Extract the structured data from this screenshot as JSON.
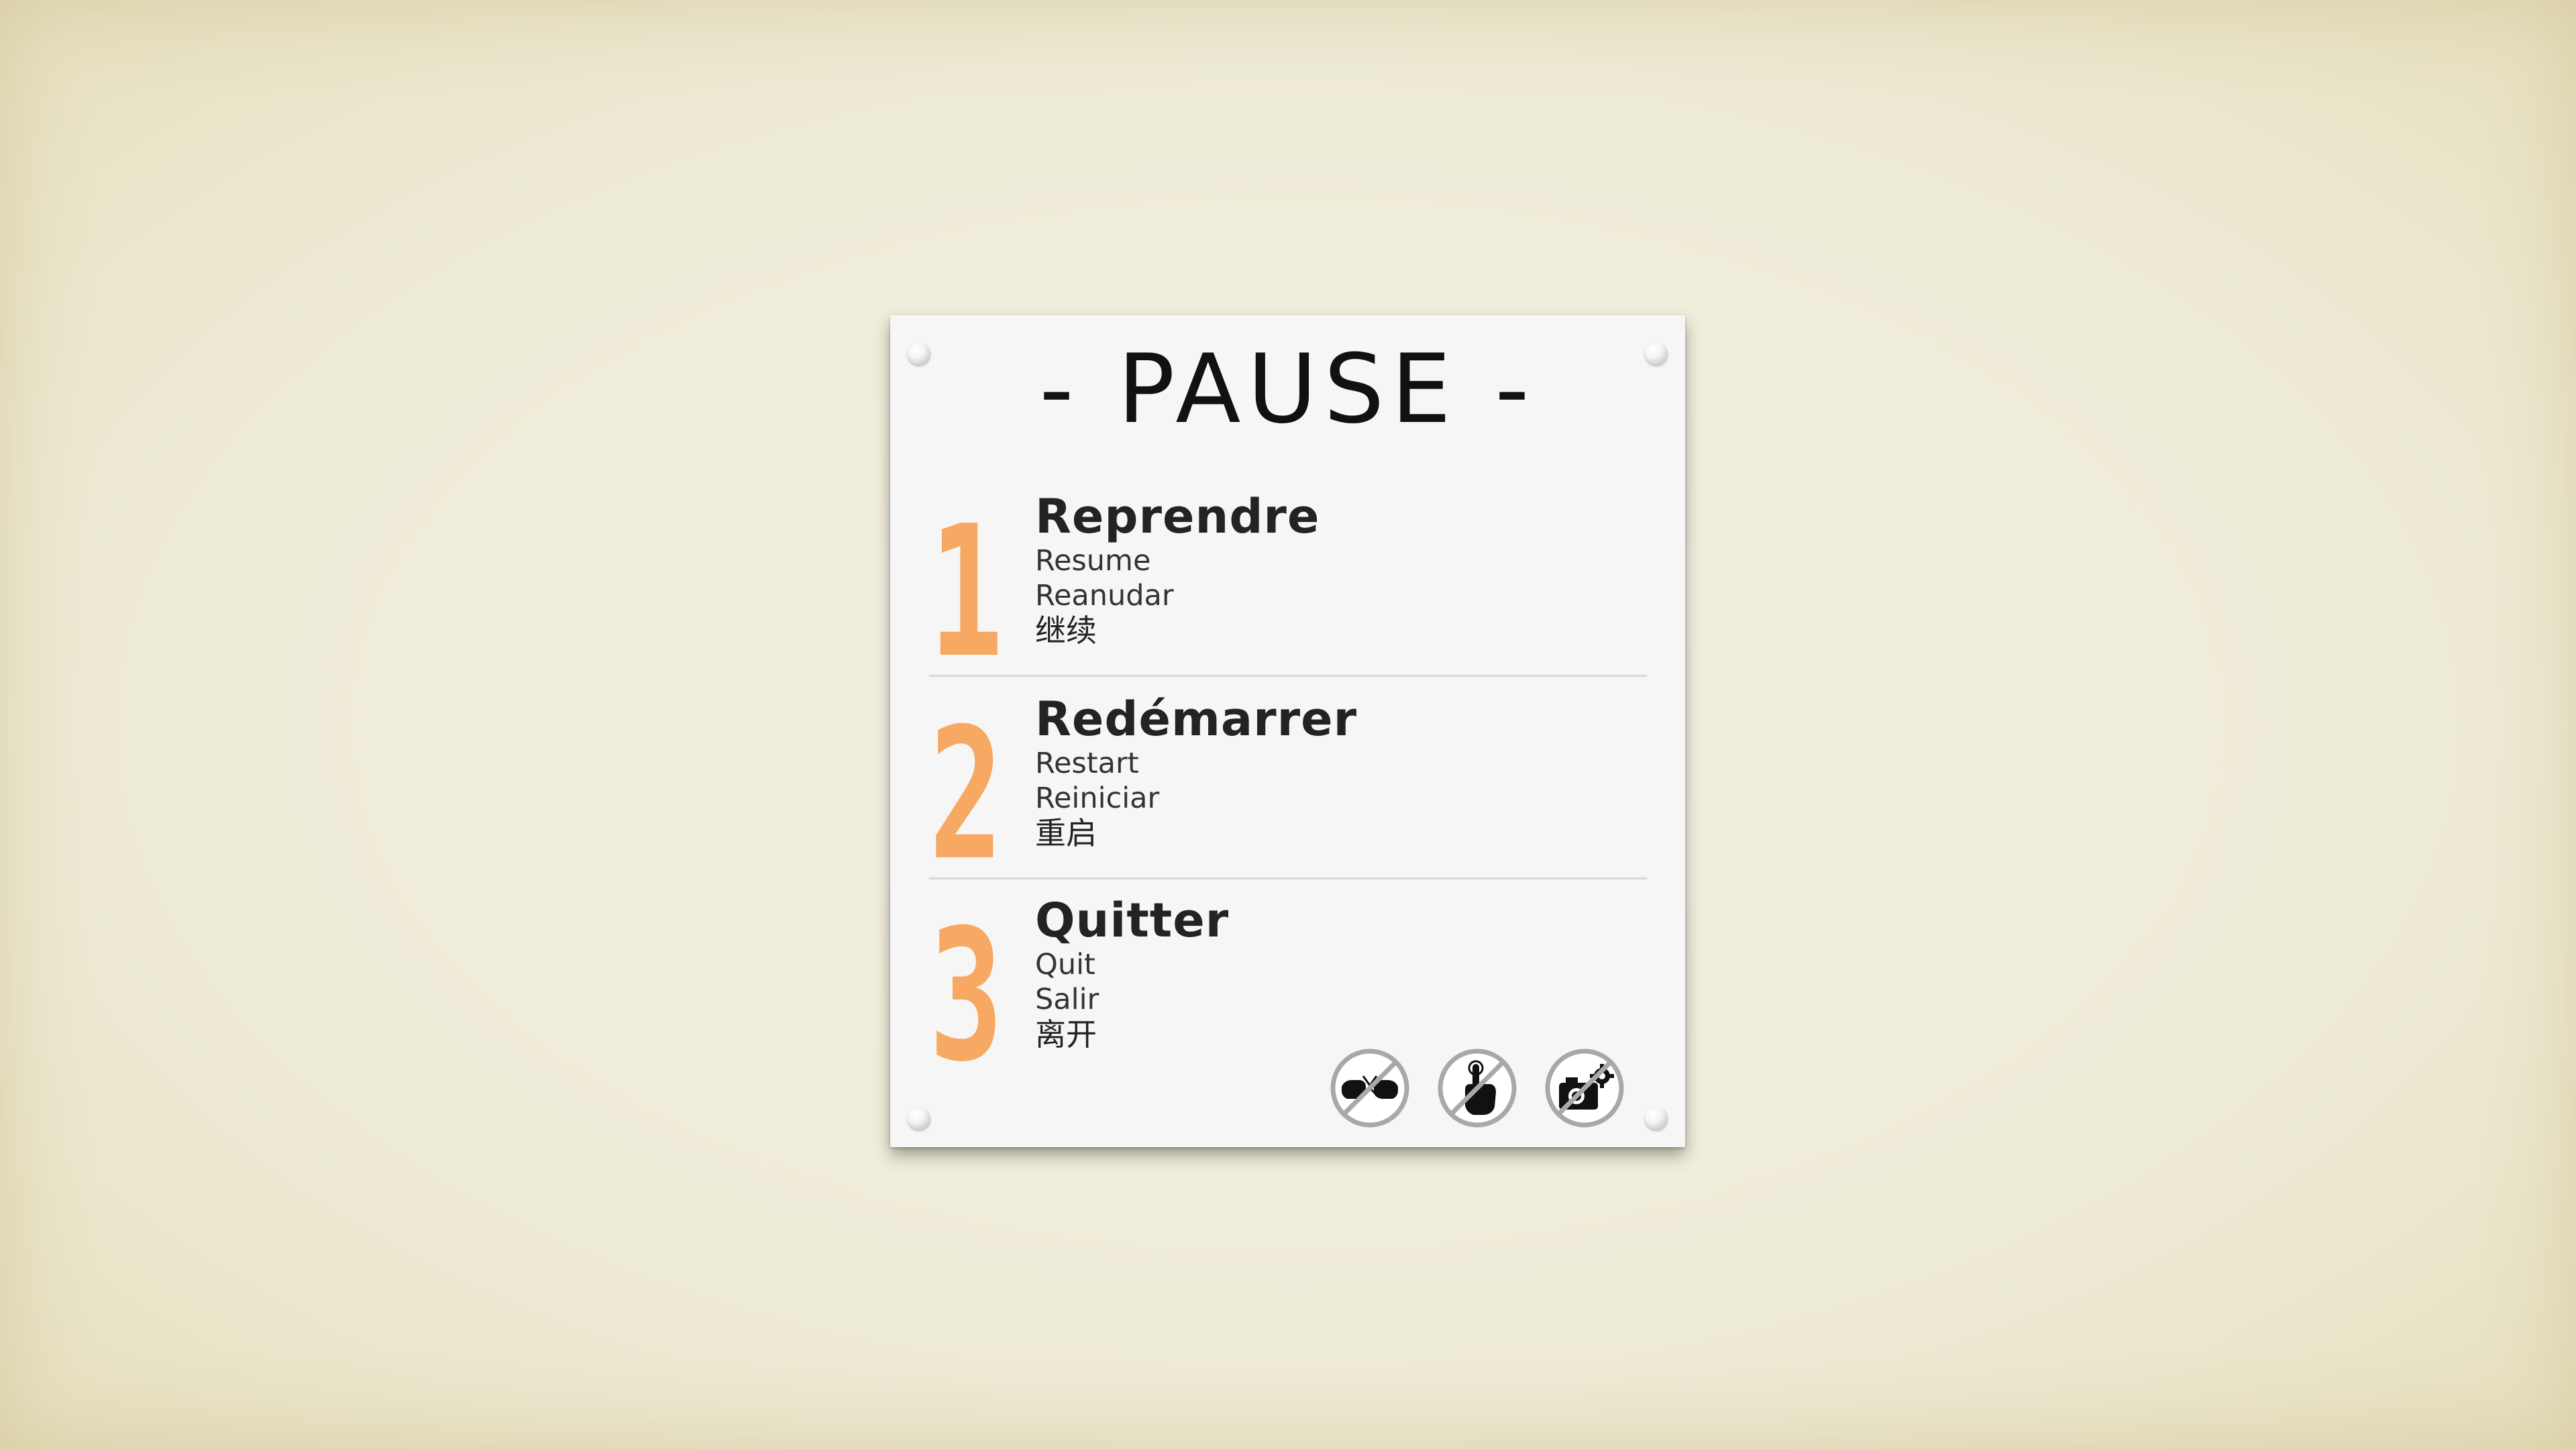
{
  "pause_menu": {
    "title": "- PAUSE -",
    "items": [
      {
        "number": "1",
        "label_fr": "Reprendre",
        "label_en": "Resume",
        "label_es": "Reanudar",
        "label_zh": "继续"
      },
      {
        "number": "2",
        "label_fr": "Redémarrer",
        "label_en": "Restart",
        "label_es": "Reiniciar",
        "label_zh": "重启"
      },
      {
        "number": "3",
        "label_fr": "Quitter",
        "label_en": "Quit",
        "label_es": "Salir",
        "label_zh": "离开"
      }
    ],
    "icons": [
      "no-fighting-icon",
      "no-touch-icon",
      "no-camera-settings-icon"
    ]
  },
  "colors": {
    "background": "#efecd8",
    "panel": "#f6f6f6",
    "number_accent": "#f7a862",
    "text_dark": "#232323",
    "divider": "#d8d8d8"
  }
}
